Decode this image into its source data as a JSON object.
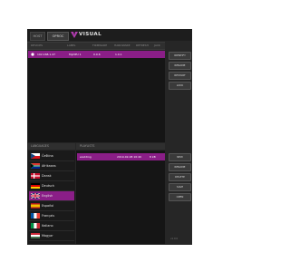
{
  "topbar": {
    "tab_left": "HOST",
    "tab_right": "OPROC",
    "logo_text": "VISUAL"
  },
  "devices": {
    "columns": [
      "DEVICES",
      "LABEL",
      "FIRMWARE",
      "HARDWARE",
      "REFRESH",
      "JACK"
    ],
    "rows": [
      {
        "address": "192.168.1.47",
        "label": "MyDPU 1",
        "firmware": "0.0.6",
        "hardware": "1.0.1",
        "refresh": "",
        "jack": ""
      }
    ]
  },
  "device_actions": {
    "identify": "IDENTIFY",
    "rename": "RENAME",
    "restart": "RESTART",
    "lock": "LOCK"
  },
  "languages": {
    "header": "LANGUAGES",
    "items": [
      {
        "label": "Čeština",
        "flag": "cz"
      },
      {
        "label": "Afrikaans",
        "flag": "za"
      },
      {
        "label": "Dansk",
        "flag": "dk"
      },
      {
        "label": "Deutsch",
        "flag": "de"
      },
      {
        "label": "English",
        "flag": "gb",
        "selected": true
      },
      {
        "label": "Español",
        "flag": "es"
      },
      {
        "label": "Français",
        "flag": "fr"
      },
      {
        "label": "Italiano",
        "flag": "it"
      },
      {
        "label": "Magyar",
        "flag": "hu"
      }
    ]
  },
  "playlists": {
    "header": "PLAYLISTS",
    "rows": [
      {
        "name": "wedding",
        "date": "2019-02-08 16:40",
        "size": "8 kB"
      }
    ]
  },
  "playlist_actions": {
    "new": "NEW",
    "rename": "RENAME",
    "delete": "DELETE",
    "save": "SAVE",
    "open": "OPEN"
  },
  "version": "v1.0.0",
  "colors": {
    "accent": "#8a1e87",
    "background": "#262626"
  }
}
